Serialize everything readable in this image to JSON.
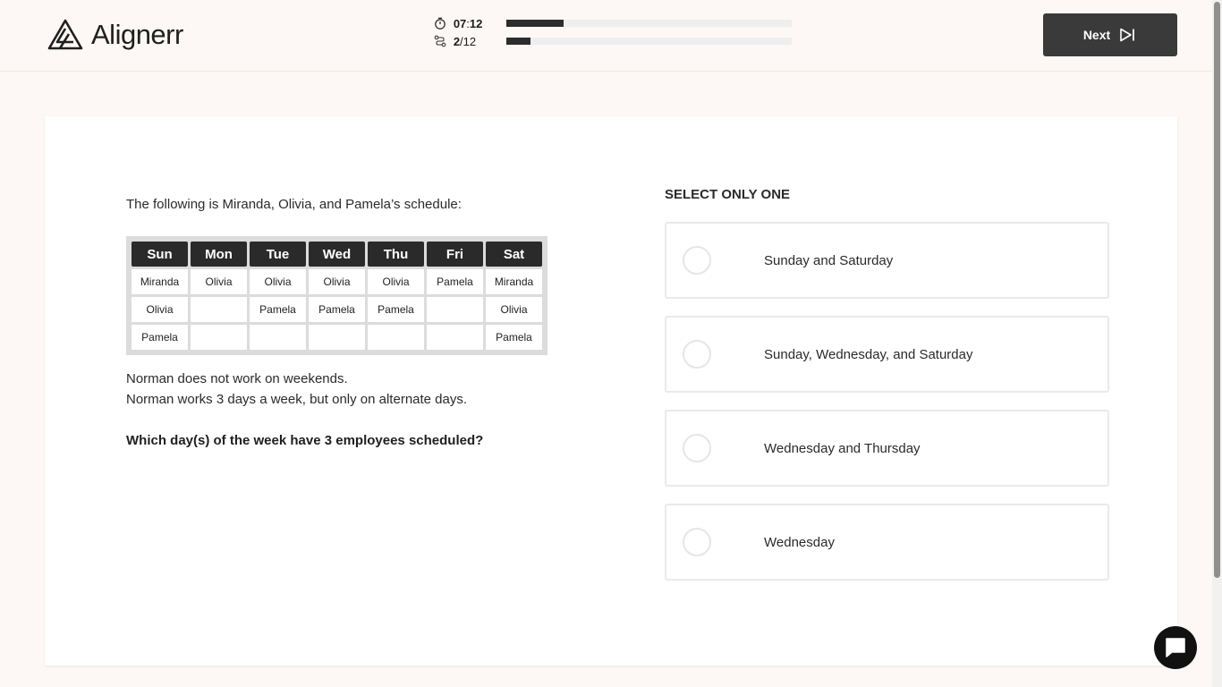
{
  "app": {
    "name": "Alignerr"
  },
  "header": {
    "timer": {
      "value": "07",
      "separator": ":",
      "seconds": "12",
      "progress": 0.2
    },
    "question_counter": {
      "current": "2",
      "total": "/12",
      "progress": 0.083
    },
    "next_label": "Next"
  },
  "question": {
    "intro": "The following is Miranda, Olivia, and Pamela’s schedule:",
    "table": {
      "headers": [
        "Sun",
        "Mon",
        "Tue",
        "Wed",
        "Thu",
        "Fri",
        "Sat"
      ],
      "rows": [
        [
          "Miranda",
          "Olivia",
          "Olivia",
          "Olivia",
          "Olivia",
          "Pamela",
          "Miranda"
        ],
        [
          "Olivia",
          "",
          "Pamela",
          "Pamela",
          "Pamela",
          "",
          "Olivia"
        ],
        [
          "Pamela",
          "",
          "",
          "",
          "",
          "",
          "Pamela"
        ]
      ]
    },
    "notes": [
      "Norman does not work on weekends.",
      "Norman works 3 days a week, but only on alternate days."
    ],
    "prompt": "Which day(s) of the week have 3 employees scheduled?"
  },
  "answers": {
    "instruction": "SELECT ONLY ONE",
    "options": [
      {
        "label": "Sunday and Saturday",
        "selected": false
      },
      {
        "label": "Sunday, Wednesday, and Saturday",
        "selected": false
      },
      {
        "label": "Wednesday and Thursday",
        "selected": false
      },
      {
        "label": "Wednesday",
        "selected": false
      }
    ]
  },
  "icons": {
    "timer": "stopwatch-icon",
    "counter": "route-icon",
    "next": "skip-forward-icon",
    "chat": "chat-bubble-icon",
    "logo": "aligner-triangle-logo"
  }
}
